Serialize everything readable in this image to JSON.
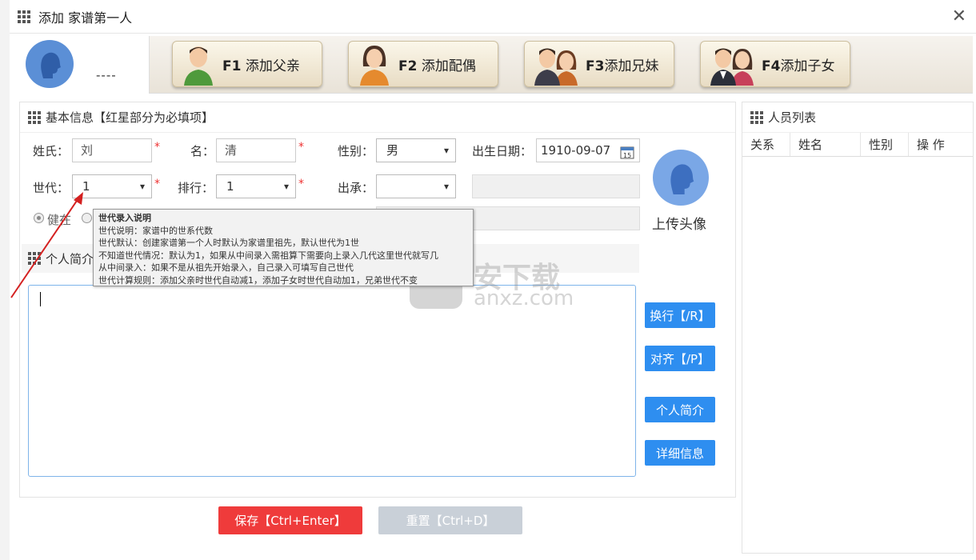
{
  "window": {
    "title": "添加 家谱第一人"
  },
  "self": {
    "name": "----"
  },
  "relation_buttons": [
    {
      "key": "F1",
      "label": "添加父亲"
    },
    {
      "key": "F2",
      "label": "添加配偶"
    },
    {
      "key": "F3",
      "label": "添加兄妹"
    },
    {
      "key": "F4",
      "label": "添加子女"
    }
  ],
  "basic": {
    "header": "基本信息【红星部分为必填项】",
    "surname_label": "姓氏：",
    "surname_value": "刘",
    "given_label": "名：",
    "given_value": "清",
    "gender_label": "性别：",
    "gender_value": "男",
    "birth_label": "出生日期：",
    "birth_value": "1910-09-07",
    "generation_label": "世代：",
    "generation_value": "1",
    "rank_label": "排行：",
    "rank_value": "1",
    "adopt_label": "出承：",
    "adopt_value": "",
    "alive_label": "健在",
    "required_mark": "*"
  },
  "upload": {
    "label": "上传头像"
  },
  "intro": {
    "header": "个人简介"
  },
  "side_buttons": {
    "newline": "换行【/R】",
    "align": "对齐【/P】",
    "intro": "个人简介",
    "detail": "详细信息"
  },
  "tooltip": {
    "title": "世代录入说明",
    "lines": [
      "世代说明：家谱中的世系代数",
      "世代默认：创建家谱第一个人时默认为家谱里祖先，默认世代为1世",
      "不知道世代情况：默认为1，如果从中间录入需祖算下需要向上录入几代这里世代就写几",
      "从中间录入：如果不是从祖先开始录入，自己录入可填写自己世代",
      "世代计算规则：添加父亲时世代自动减1，添加子女时世代自动加1，兄弟世代不变"
    ]
  },
  "actions": {
    "save": "保存【Ctrl+Enter】",
    "reset": "重置【Ctrl+D】"
  },
  "person_list": {
    "header": "人员列表",
    "columns": [
      "关系",
      "姓名",
      "性别",
      "操 作"
    ]
  },
  "watermark": {
    "text": "安下载",
    "sub": "anxz.com"
  },
  "colors": {
    "primary": "#2e8ef0",
    "danger": "#ef3b3b",
    "disabled": "#c9d0d8",
    "required": "#ee3333"
  }
}
